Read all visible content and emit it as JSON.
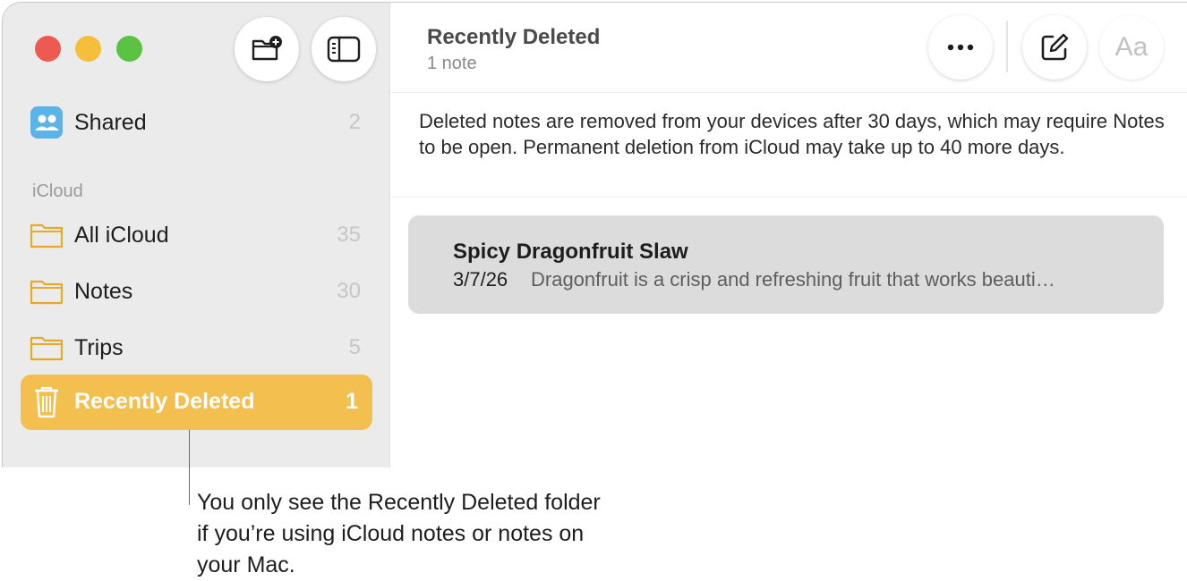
{
  "sidebar": {
    "shared": {
      "label": "Shared",
      "count": "2"
    },
    "section_label": "iCloud",
    "folders": [
      {
        "label": "All iCloud",
        "count": "35"
      },
      {
        "label": "Notes",
        "count": "30"
      },
      {
        "label": "Trips",
        "count": "5"
      }
    ],
    "selected": {
      "label": "Recently Deleted",
      "count": "1"
    }
  },
  "header": {
    "title": "Recently Deleted",
    "subtitle": "1 note",
    "format_label": "Aa"
  },
  "info_text": "Deleted notes are removed from your devices after 30 days, which may require Notes to be open. Permanent deletion from iCloud may take up to 40 more days.",
  "note": {
    "title": "Spicy Dragonfruit Slaw",
    "date": "3/7/26",
    "preview": "Dragonfruit is a crisp and refreshing fruit that works beauti…"
  },
  "callout": "You only see the Recently Deleted folder if you’re using iCloud notes or notes on your Mac.",
  "icons": [
    "new-folder-icon",
    "sidebar-toggle-icon",
    "shared-icon",
    "folder-icon",
    "trash-icon",
    "more-icon",
    "compose-icon"
  ],
  "colors": {
    "accent": "#f3bf4e",
    "sidebar_bg": "#ebebeb",
    "card_bg": "#dcdcdc"
  }
}
